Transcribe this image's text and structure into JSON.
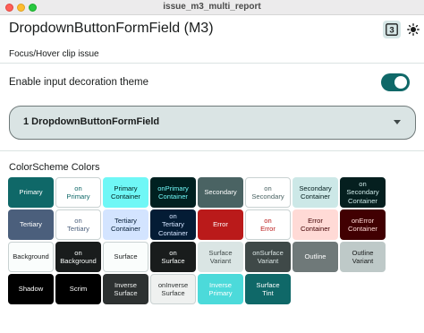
{
  "window": {
    "title": "issue_m3_multi_report"
  },
  "appbar": {
    "title": "DropdownButtonFormField (M3)"
  },
  "subtitle": "Focus/Hover clip issue",
  "toggle": {
    "label": "Enable input decoration theme",
    "on": true
  },
  "dropdown": {
    "value": "1 DropdownButtonFormField"
  },
  "colors_section": {
    "title": "ColorScheme Colors"
  },
  "swatches": [
    [
      {
        "label": "Primary",
        "bg": "#0f6868",
        "fg": "#ffffff"
      },
      {
        "label": "on\nPrimary",
        "bg": "#ffffff",
        "fg": "#0f6868"
      },
      {
        "label": "Primary\nContainer",
        "bg": "#6ff7f6",
        "fg": "#002020"
      },
      {
        "label": "onPrimary\nContainer",
        "bg": "#002020",
        "fg": "#6ff7f6"
      },
      {
        "label": "Secondary",
        "bg": "#4a6363",
        "fg": "#ffffff"
      },
      {
        "label": "on\nSecondary",
        "bg": "#ffffff",
        "fg": "#4a6363"
      },
      {
        "label": "Secondary\nContainer",
        "bg": "#cce8e7",
        "fg": "#051f1f"
      },
      {
        "label": "on\nSecondary\nContainer",
        "bg": "#051f1f",
        "fg": "#cce8e7"
      }
    ],
    [
      {
        "label": "Tertiary",
        "bg": "#4b5f7c",
        "fg": "#ffffff"
      },
      {
        "label": "on\nTertiary",
        "bg": "#ffffff",
        "fg": "#4b5f7c"
      },
      {
        "label": "Tertiary\nContainer",
        "bg": "#d3e4ff",
        "fg": "#041c35"
      },
      {
        "label": "on\nTertiary\nContainer",
        "bg": "#041c35",
        "fg": "#d3e4ff"
      },
      {
        "label": "Error",
        "bg": "#ba1a1a",
        "fg": "#ffffff"
      },
      {
        "label": "on\nError",
        "bg": "#ffffff",
        "fg": "#ba1a1a"
      },
      {
        "label": "Error\nContainer",
        "bg": "#ffdad6",
        "fg": "#410002"
      },
      {
        "label": "onError\nContainer",
        "bg": "#410002",
        "fg": "#ffdad6"
      }
    ],
    [
      {
        "label": "Background",
        "bg": "#fafdfc",
        "fg": "#191c1c"
      },
      {
        "label": "on\nBackground",
        "bg": "#191c1c",
        "fg": "#fafdfc"
      },
      {
        "label": "Surface",
        "bg": "#fafdfc",
        "fg": "#191c1c"
      },
      {
        "label": "on\nSurface",
        "bg": "#191c1c",
        "fg": "#fafdfc"
      },
      {
        "label": "Surface\nVariant",
        "bg": "#dae5e4",
        "fg": "#3f4948"
      },
      {
        "label": "onSurface\nVariant",
        "bg": "#3f4948",
        "fg": "#dae5e4"
      },
      {
        "label": "Outline",
        "bg": "#6f7979",
        "fg": "#ffffff"
      },
      {
        "label": "Outline\nVariant",
        "bg": "#bec9c8",
        "fg": "#191c1c"
      }
    ],
    [
      {
        "label": "Shadow",
        "bg": "#000000",
        "fg": "#ffffff"
      },
      {
        "label": "Scrim",
        "bg": "#000000",
        "fg": "#ffffff"
      },
      {
        "label": "Inverse\nSurface",
        "bg": "#2d3131",
        "fg": "#eff1f0"
      },
      {
        "label": "onInverse\nSurface",
        "bg": "#eff1f0",
        "fg": "#2d3131"
      },
      {
        "label": "Inverse\nPrimary",
        "bg": "#4cdada",
        "fg": "#ffffff"
      },
      {
        "label": "Surface\nTint",
        "bg": "#0f6868",
        "fg": "#ffffff"
      }
    ]
  ]
}
